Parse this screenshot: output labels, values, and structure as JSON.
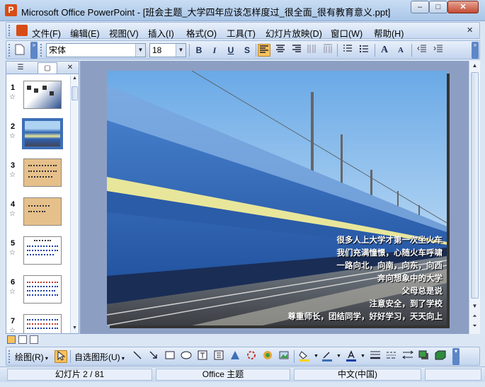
{
  "window": {
    "title": "Microsoft Office PowerPoint - [班会主题_大学四年应该怎样度过_很全面_很有教育意义.ppt]",
    "app_icon": "P",
    "controls": {
      "minimize": "–",
      "maximize": "□",
      "close": "✕"
    }
  },
  "menu": {
    "items": [
      "文件(F)",
      "编辑(E)",
      "视图(V)",
      "插入(I)",
      "格式(O)",
      "工具(T)",
      "幻灯片放映(D)",
      "窗口(W)",
      "帮助(H)"
    ],
    "close_doc": "✕"
  },
  "toolbar": {
    "font": "宋体",
    "size": "18",
    "bold": "B",
    "italic": "I",
    "underline": "U",
    "shadow": "S",
    "bigger_font": "A",
    "smaller_font": "A"
  },
  "left_panel": {
    "tab_outline": "☰",
    "tab_slides": "▢",
    "close": "✕",
    "slide_numbers": [
      "1",
      "2",
      "3",
      "4",
      "5",
      "6",
      "7"
    ],
    "selected_index": 1,
    "star": "☆"
  },
  "slide": {
    "lines": [
      "很多人上大学才第一次坐火车",
      "我们充满憧憬，心随火车呼啸",
      "一路向北，向南，向东，向西",
      "奔向想象中的大学",
      "父母总是说",
      "注意安全，到了学校",
      "尊重师长，团结同学，好好学习，天天向上"
    ]
  },
  "drawbar": {
    "draw": "绘图(R)",
    "autoshapes": "自选图形(U)"
  },
  "status": {
    "slide": "幻灯片 2 / 81",
    "theme": "Office 主题",
    "lang": "中文(中国)"
  },
  "colors": {
    "title_gradient_top": "#c9ddf3",
    "accent_orange": "#f9c25b",
    "slide_sky": "#9ec8ef",
    "train_blue": "#2d62b3",
    "train_stripe": "#e8e69a"
  }
}
